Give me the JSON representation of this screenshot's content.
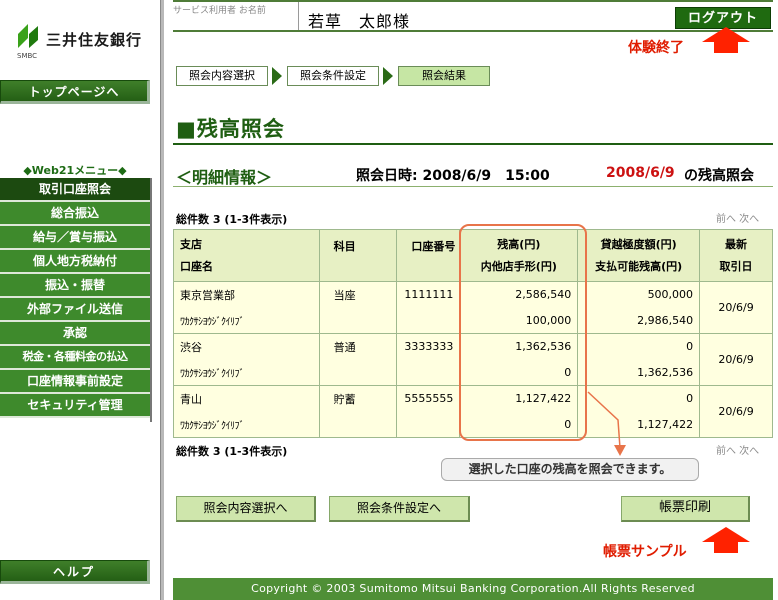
{
  "logo": {
    "name": "三井住友銀行",
    "sub": "SMBC"
  },
  "sidebar": {
    "top_page": "トップページへ",
    "web21_label": "◆Web21メニュー◆",
    "menu": [
      "取引口座照会",
      "総合振込",
      "給与／賞与振込",
      "個人地方税納付",
      "振込・振替",
      "外部ファイル送信",
      "承認",
      "税金・各種料金の払込",
      "口座情報事前設定",
      "セキュリティ管理"
    ],
    "help": "ヘルプ"
  },
  "header": {
    "user_caption": "サービス利用者 お名前",
    "user_name": "若草　太郎様",
    "logout": "ログアウト",
    "logout_note": "体験終了"
  },
  "breadcrumb": [
    "照会内容選択",
    "照会条件設定",
    "照会結果"
  ],
  "page_title": "■残高照会",
  "detail": {
    "heading": "＜明細情報＞",
    "inquiry_time": "照会日時: 2008/6/9　15:00",
    "inquiry_date_red": "2008/6/9",
    "inquiry_suffix": "の残高照会"
  },
  "total_count": "総件数 3 (1-3件表示)",
  "pager": "前へ 次へ",
  "table": {
    "headers": {
      "branch": "支店",
      "account_name": "口座名",
      "subject": "科目",
      "account_no": "口座番号",
      "balance": "残高(円)",
      "bills": "内他店手形(円)",
      "overdraft": "貸越極度額(円)",
      "available": "支払可能残高(円)",
      "latest": "最新",
      "trade_date": "取引日"
    },
    "rows": [
      {
        "branch": "東京営業部",
        "kana": "ﾜｶｸｻｼﾖｳｼﾞｸｲﾘﾌﾞ",
        "subject": "当座",
        "account_no": "1111111",
        "balance": "2,586,540",
        "bills": "100,000",
        "overdraft": "500,000",
        "available": "2,986,540",
        "date": "20/6/9"
      },
      {
        "branch": "渋谷",
        "kana": "ﾜｶｸｻｼﾖｳｼﾞｸｲﾘﾌﾞ",
        "subject": "普通",
        "account_no": "3333333",
        "balance": "1,362,536",
        "bills": "0",
        "overdraft": "0",
        "available": "1,362,536",
        "date": "20/6/9"
      },
      {
        "branch": "青山",
        "kana": "ﾜｶｸｻｼﾖｳｼﾞｸｲﾘﾌﾞ",
        "subject": "貯蓄",
        "account_no": "5555555",
        "balance": "1,127,422",
        "bills": "0",
        "overdraft": "0",
        "available": "1,127,422",
        "date": "20/6/9"
      }
    ]
  },
  "callout": "選択した口座の残高を照会できます。",
  "buttons": {
    "select": "照会内容選択へ",
    "conditions": "照会条件設定へ",
    "print": "帳票印刷",
    "print_note": "帳票サンプル"
  },
  "footer": "Copyright © 2003 Sumitomo Mitsui Banking Corporation.All Rights Reserved",
  "colors": {
    "brand_green": "#1f5e12",
    "note_red": "#e01c00",
    "highlight_orange": "#e8744a"
  }
}
